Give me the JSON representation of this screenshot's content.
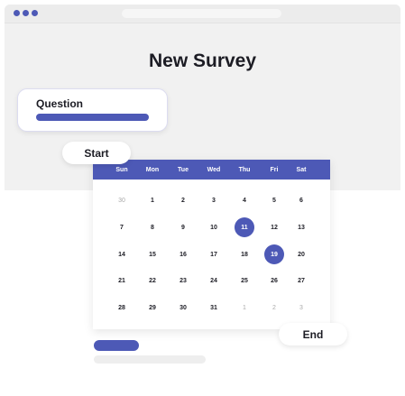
{
  "page": {
    "title": "New Survey"
  },
  "question": {
    "label": "Question"
  },
  "range": {
    "start_label": "Start",
    "end_label": "End"
  },
  "colors": {
    "accent": "#4d59b6",
    "window_bg": "#f1f1f1",
    "text": "#1c1c24",
    "muted": "#aaaaaa"
  },
  "calendar": {
    "weekdays": [
      "Sun",
      "Mon",
      "Tue",
      "Wed",
      "Thu",
      "Fri",
      "Sat"
    ],
    "weeks": [
      [
        "30",
        "1",
        "2",
        "3",
        "4",
        "5",
        "6"
      ],
      [
        "7",
        "8",
        "9",
        "10",
        "11",
        "12",
        "13"
      ],
      [
        "14",
        "15",
        "16",
        "17",
        "18",
        "19",
        "20"
      ],
      [
        "21",
        "22",
        "23",
        "24",
        "25",
        "26",
        "27"
      ],
      [
        "28",
        "29",
        "30",
        "31",
        "1",
        "2",
        "3"
      ]
    ],
    "muted_days": [
      [
        0,
        0
      ],
      [
        4,
        4
      ],
      [
        4,
        5
      ],
      [
        4,
        6
      ]
    ],
    "selected_days": [
      [
        1,
        4
      ],
      [
        2,
        5
      ]
    ]
  }
}
